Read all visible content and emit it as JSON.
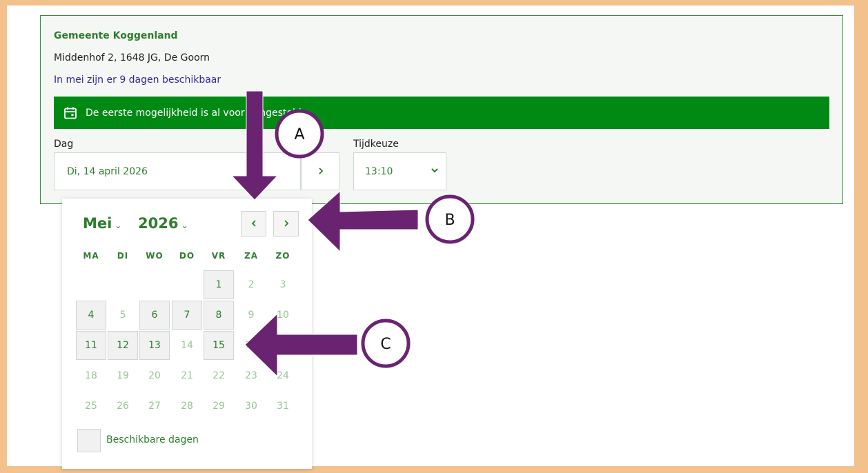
{
  "appointment": {
    "organization": "Gemeente Koggenland",
    "address": "Middenhof 2, 1648 JG, De Goorn",
    "availability_text": "In mei zijn er 9 dagen beschikbaar",
    "banner_text": "De eerste mogelijkheid is al voor u ingesteld",
    "day_label": "Dag",
    "day_value": "Di, 14 april 2026",
    "time_label": "Tijdkeuze",
    "time_value": "13:10"
  },
  "calendar": {
    "month": "Mei",
    "year": "2026",
    "weekdays": [
      "MA",
      "DI",
      "WO",
      "DO",
      "VR",
      "ZA",
      "ZO"
    ],
    "weeks": [
      [
        null,
        null,
        null,
        null,
        "1",
        "2",
        "3"
      ],
      [
        "4",
        "5",
        "6",
        "7",
        "8",
        "9",
        "10"
      ],
      [
        "11",
        "12",
        "13",
        "14",
        "15",
        "16",
        "17"
      ],
      [
        "18",
        "19",
        "20",
        "21",
        "22",
        "23",
        "24"
      ],
      [
        "25",
        "26",
        "27",
        "28",
        "29",
        "30",
        "31"
      ]
    ],
    "available_days": [
      "1",
      "4",
      "6",
      "7",
      "8",
      "11",
      "12",
      "13",
      "15"
    ],
    "legend_text": "Beschikbare dagen"
  },
  "annotations": {
    "labels": [
      "A",
      "B",
      "C"
    ],
    "arrow_color": "#6a2371",
    "frame_color": "#f3c28c"
  },
  "icons": {
    "banner": "calendar-check-icon",
    "prev": "chevron-left-icon",
    "next": "chevron-right-icon",
    "dropdown": "chevron-down-icon"
  }
}
